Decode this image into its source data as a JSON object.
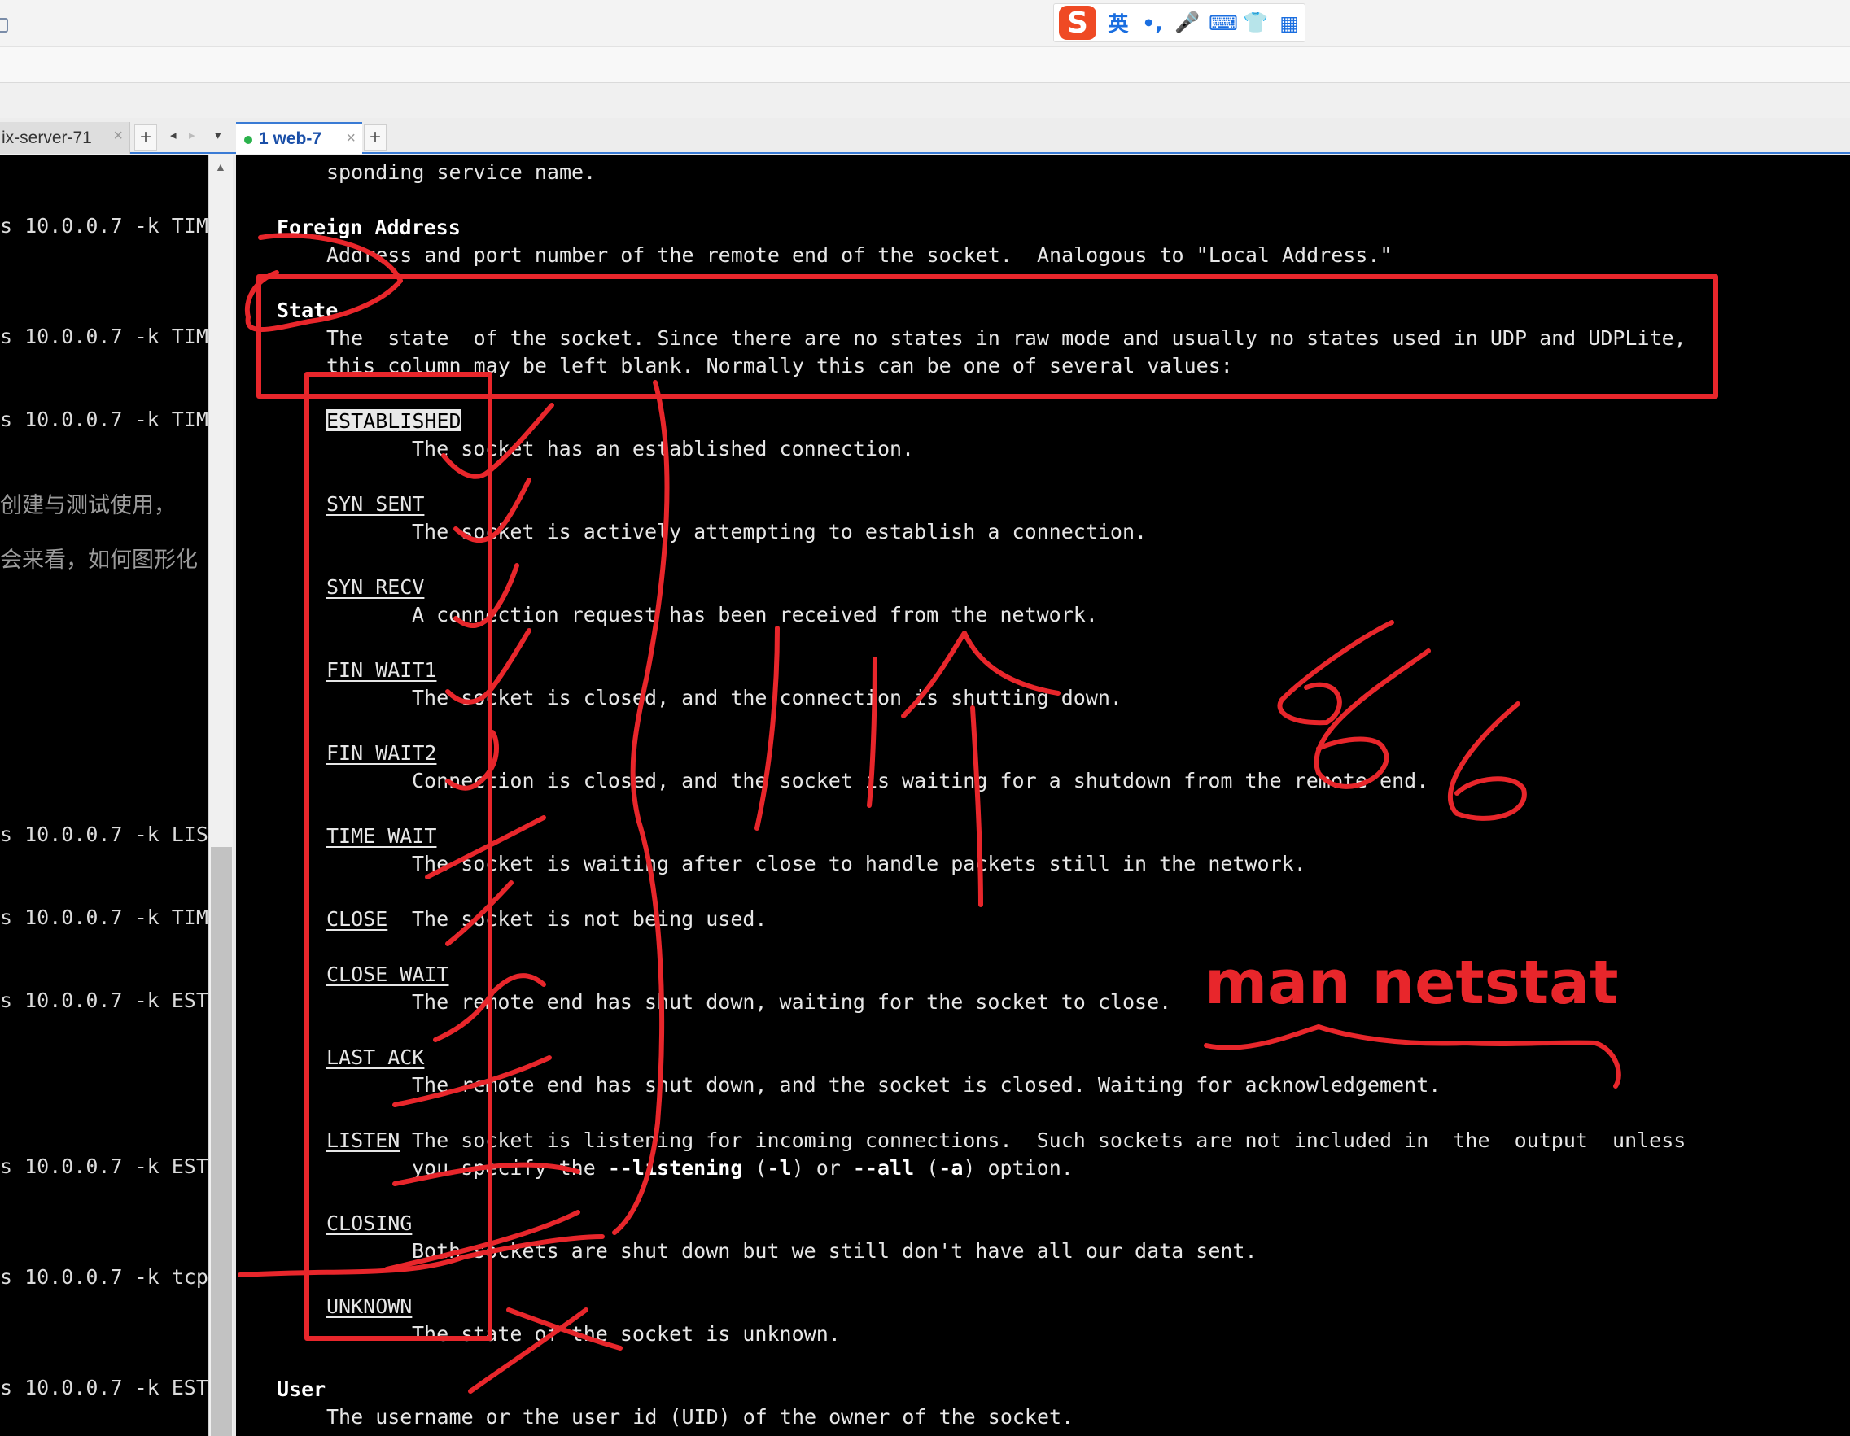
{
  "ime": {
    "logo": "S",
    "mode": "英",
    "punct": "•,",
    "icons": [
      "mic-icon",
      "keyboard-icon",
      "shirt-icon",
      "apps-icon"
    ],
    "mic": "🎤",
    "keyboard": "⌨",
    "shirt": "👕",
    "apps": "▦"
  },
  "tabs": {
    "left_label": "ix-server-71",
    "left_close": "×",
    "right_label": "1 web-7",
    "right_close": "×",
    "plus": "+",
    "prev": "◂",
    "next": "▸",
    "menu": "▾"
  },
  "left_terminal": {
    "lines": [
      "s 10.0.0.7 -k TIM",
      "s 10.0.0.7 -k TIM",
      "s 10.0.0.7 -k TIM",
      "s 10.0.0.7 -k LIS",
      "s 10.0.0.7 -k TIM",
      "s 10.0.0.7 -k EST",
      "s 10.0.0.7 -k EST",
      "s 10.0.0.7 -k tcp",
      "s 10.0.0.7 -k EST"
    ],
    "cn_lines": [
      "创建与测试使用，",
      "会来看，如何图形化"
    ]
  },
  "man_page": {
    "intro": "sponding service name.",
    "foreign_heading": "Foreign Address",
    "foreign_desc": "Address and port number of the remote end of the socket.  Analogous to \"Local Address.\"",
    "state_heading": "State",
    "state_desc_1": "The  state  of the socket. Since there are no states in raw mode and usually no states used in UDP and UDPLite,",
    "state_desc_2": "this column may be left blank. Normally this can be one of several values:",
    "states": [
      {
        "name": "ESTABLISHED",
        "desc": "The socket has an established connection."
      },
      {
        "name": "SYN_SENT",
        "desc": "The socket is actively attempting to establish a connection."
      },
      {
        "name": "SYN_RECV",
        "desc": "A connection request has been received from the network."
      },
      {
        "name": "FIN_WAIT1",
        "desc": "The socket is closed, and the connection is shutting down."
      },
      {
        "name": "FIN_WAIT2",
        "desc": "Connection is closed, and the socket is waiting for a shutdown from the remote end."
      },
      {
        "name": "TIME_WAIT",
        "desc": "The socket is waiting after close to handle packets still in the network."
      },
      {
        "name": "CLOSE",
        "desc": "The socket is not being used."
      },
      {
        "name": "CLOSE_WAIT",
        "desc": "The remote end has shut down, waiting for the socket to close."
      },
      {
        "name": "LAST_ACK",
        "desc": "The remote end has shut down, and the socket is closed. Waiting for acknowledgement."
      },
      {
        "name": "LISTEN",
        "desc": "The socket is listening for incoming connections.  Such sockets are not included in  the  output  unless"
      },
      {
        "name": "CLOSING",
        "desc": "Both sockets are shut down but we still don't have all our data sent."
      },
      {
        "name": "UNKNOWN",
        "desc": "The state of the socket is unknown."
      }
    ],
    "listen_cont_1": "you specify the ",
    "listen_opt_1": "--listening",
    "listen_cont_2": " (",
    "listen_opt_2": "-l",
    "listen_cont_3": ") or ",
    "listen_opt_3": "--all",
    "listen_cont_4": " (",
    "listen_opt_4": "-a",
    "listen_cont_5": ") option.",
    "user_heading": "User",
    "user_desc": "The username or the user id (UID) of the owner of the socket."
  },
  "annotations": {
    "text_666": "666",
    "text_man": "man netstat",
    "color": "#e8262b"
  }
}
